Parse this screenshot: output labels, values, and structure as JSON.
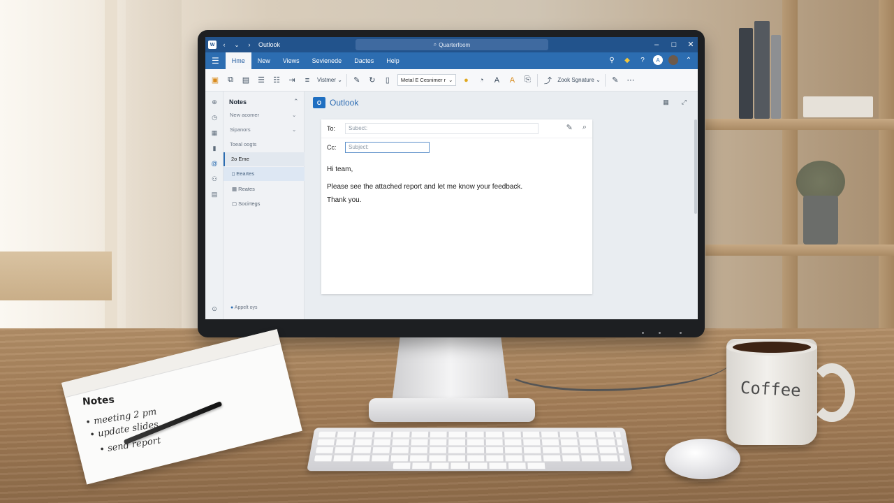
{
  "titlebar": {
    "title": "Outlook",
    "search": "Quarterfoom",
    "minimize": "–",
    "maximize": "□",
    "close": "✕"
  },
  "menu": {
    "items": [
      "Hme",
      "New",
      "Views",
      "Sevienede",
      "Dactes",
      "Help"
    ]
  },
  "ribbon": {
    "view_label": "Vistmer",
    "font_select": "Metal E Cesnimer r",
    "signature": "Zook Sgnature"
  },
  "nav": {
    "header": "Notes",
    "items": [
      "New acomer",
      "Sipanors",
      "Toeal oogts",
      "2o Eme",
      "Eeartes",
      "Reates",
      "Socirtegs"
    ],
    "footer": "Appelt oys"
  },
  "main": {
    "app_title": "Outlook",
    "to_label": "To:",
    "cc_label": "Cc:",
    "to_placeholder": "Subect:",
    "cc_placeholder": "Subject:",
    "body": [
      "Hi team,",
      "Please see the attached report and let me know your feedback.",
      "Thank you."
    ]
  },
  "desk": {
    "notepad_title": "Notes",
    "notepad_lines": [
      "• meeting 2 pm",
      "• update slides",
      "• send report"
    ],
    "mug_text": "Coffee"
  }
}
